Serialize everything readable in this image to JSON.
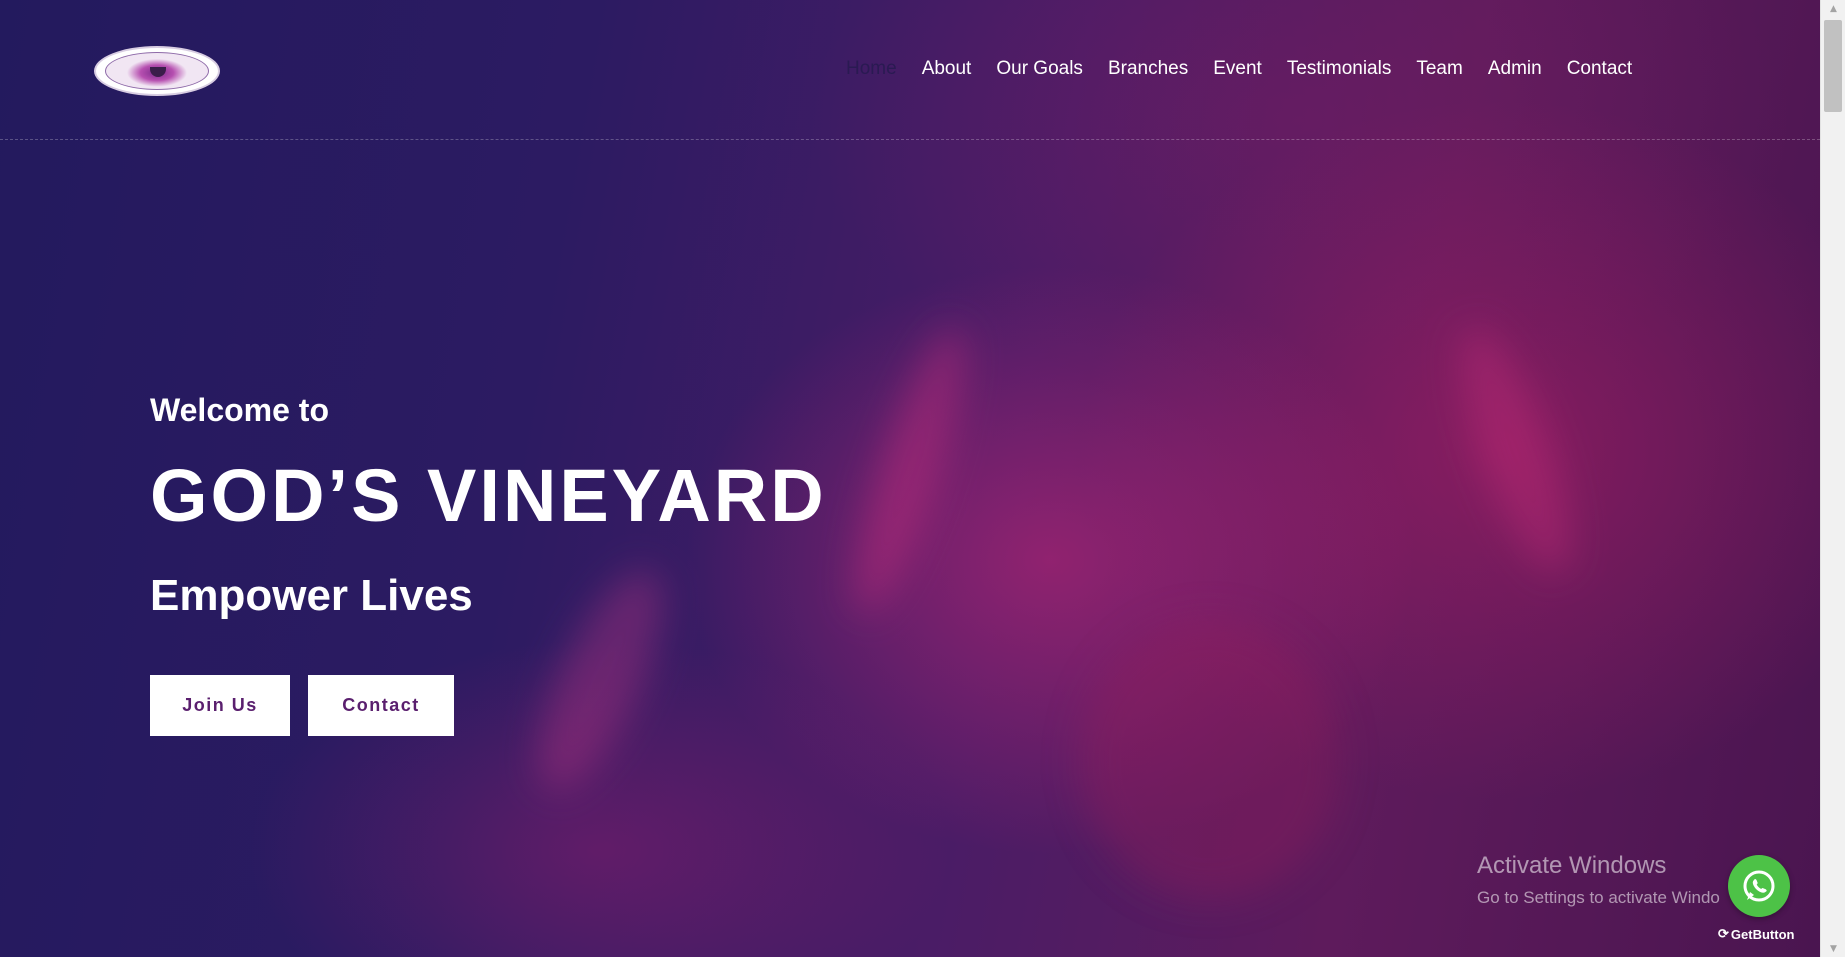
{
  "nav": {
    "items": [
      {
        "label": "Home",
        "active": true
      },
      {
        "label": "About"
      },
      {
        "label": "Our Goals"
      },
      {
        "label": "Branches"
      },
      {
        "label": "Event"
      },
      {
        "label": "Testimonials"
      },
      {
        "label": "Team"
      },
      {
        "label": "Admin"
      },
      {
        "label": "Contact"
      }
    ]
  },
  "hero": {
    "welcome": "Welcome to",
    "title": "GOD’S VINEYARD",
    "subtitle": "Empower Lives",
    "join_label": "Join Us",
    "contact_label": "Contact"
  },
  "overlay": {
    "activate_title": "Activate Windows",
    "activate_sub": "Go to Settings to activate Windo"
  },
  "widget": {
    "brand": "GetButton",
    "icon": "whatsapp-icon",
    "color": "#4dc247"
  },
  "colors": {
    "accent_text": "#5a1f6e",
    "active_nav": "#2a1a52"
  }
}
